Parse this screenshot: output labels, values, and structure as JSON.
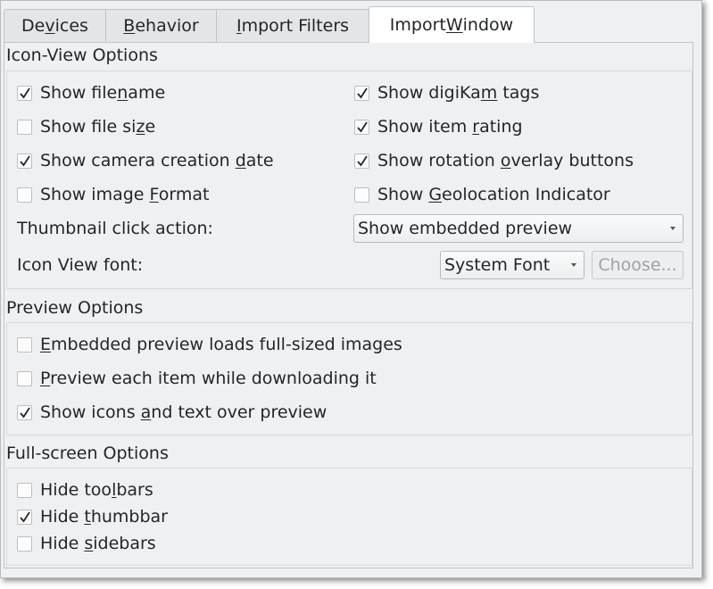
{
  "tabs": [
    {
      "pre": "De",
      "u": "v",
      "post": "ices"
    },
    {
      "pre": "",
      "u": "B",
      "post": "ehavior"
    },
    {
      "pre": "",
      "u": "I",
      "post": "mport Filters"
    },
    {
      "pre": "Import ",
      "u": "W",
      "post": "indow"
    }
  ],
  "icon_view": {
    "title": "Icon-View Options",
    "left": [
      {
        "pre": "Show file",
        "u": "n",
        "post": "ame",
        "checked": true
      },
      {
        "pre": "Show file si",
        "u": "z",
        "post": "e",
        "checked": false
      },
      {
        "pre": "Show camera creation ",
        "u": "d",
        "post": "ate",
        "checked": true
      },
      {
        "pre": "Show image ",
        "u": "F",
        "post": "ormat",
        "checked": false
      }
    ],
    "right": [
      {
        "pre": "Show digiKa",
        "u": "m",
        "post": " tags",
        "checked": true
      },
      {
        "pre": "Show item ",
        "u": "r",
        "post": "ating",
        "checked": true
      },
      {
        "pre": "Show rotation ",
        "u": "o",
        "post": "verlay buttons",
        "checked": true
      },
      {
        "pre": "Show ",
        "u": "G",
        "post": "eolocation Indicator",
        "checked": false
      }
    ],
    "thumb_label": "Thumbnail click action:",
    "thumb_value": "Show embedded preview",
    "font_label": "Icon View font:",
    "font_value": "System Font",
    "choose_label": "Choose..."
  },
  "preview": {
    "title": "Preview Options",
    "items": [
      {
        "pre": "",
        "u": "E",
        "post": "mbedded preview loads full-sized images",
        "checked": false
      },
      {
        "pre": "",
        "u": "P",
        "post": "review each item while downloading it",
        "checked": false
      },
      {
        "pre": "Show icons ",
        "u": "a",
        "post": "nd text over preview",
        "checked": true
      }
    ]
  },
  "fullscreen": {
    "title": "Full-screen Options",
    "items": [
      {
        "pre": "Hide too",
        "u": "l",
        "post": "bars",
        "checked": false
      },
      {
        "pre": "Hide ",
        "u": "t",
        "post": "humbbar",
        "checked": true
      },
      {
        "pre": "Hide ",
        "u": "s",
        "post": "idebars",
        "checked": false
      }
    ]
  }
}
